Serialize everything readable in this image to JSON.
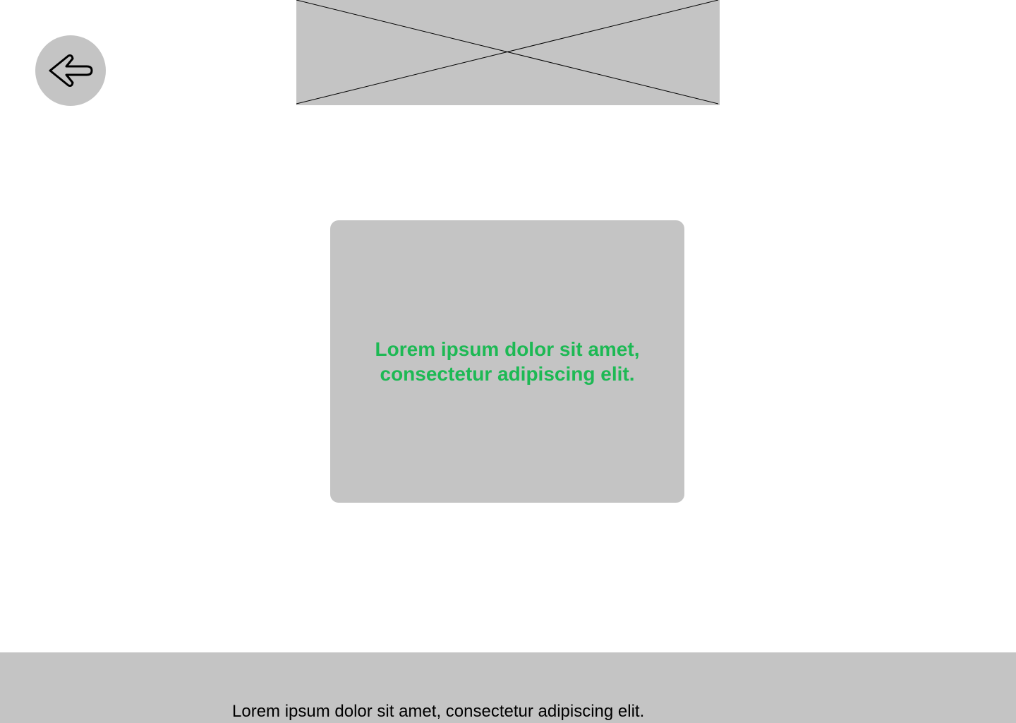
{
  "header": {
    "back_icon": "arrow-left-icon",
    "banner_icon": "image-placeholder-icon"
  },
  "main": {
    "card_text": "Lorem ipsum dolor sit amet, consectetur adipiscing elit."
  },
  "footer": {
    "text": "Lorem ipsum dolor sit amet, consectetur adipiscing elit."
  },
  "colors": {
    "placeholder_gray": "#c4c4c4",
    "accent_green": "#1db954",
    "background": "#ffffff",
    "text": "#000000"
  }
}
